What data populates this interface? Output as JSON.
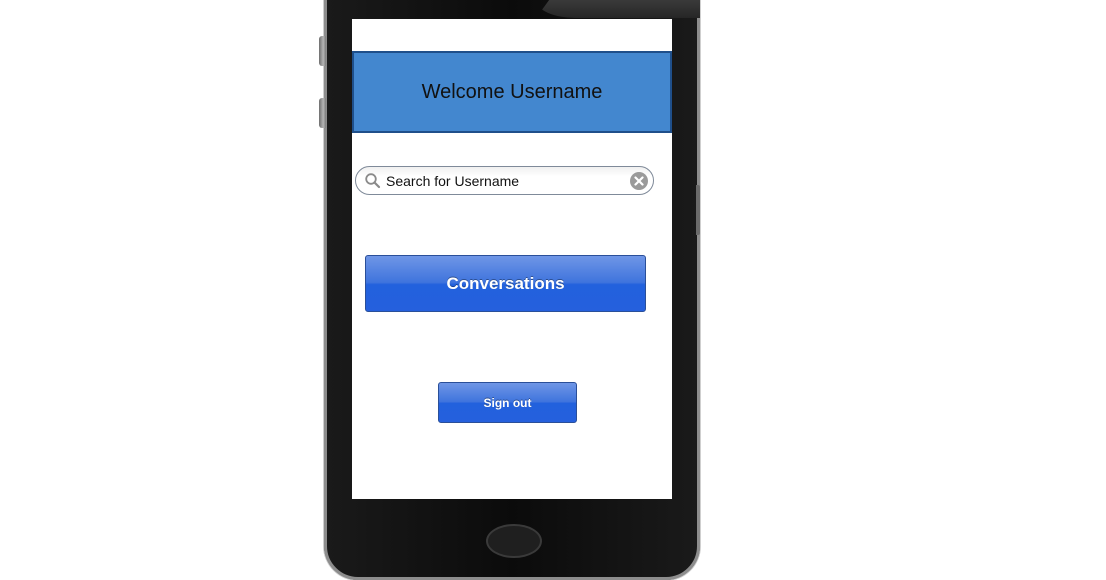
{
  "header": {
    "welcome_text": "Welcome Username"
  },
  "search": {
    "value": "Search for Username"
  },
  "buttons": {
    "conversations_label": "Conversations",
    "signout_label": "Sign out"
  },
  "colors": {
    "header_bg": "#4387cf",
    "button_blue": "#2261dd",
    "phone_body": "#0b0b0b"
  },
  "icons": [
    "search-icon",
    "clear-icon"
  ]
}
